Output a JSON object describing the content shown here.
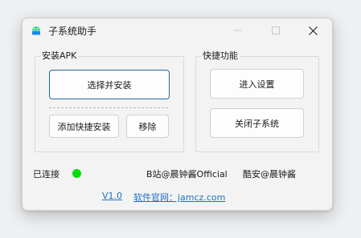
{
  "window": {
    "title": "子系统助手"
  },
  "groups": {
    "apk": {
      "legend": "安装APK",
      "select_install_label": "选择并安装",
      "add_shortcut_label": "添加快捷安装",
      "remove_label": "移除"
    },
    "quick": {
      "legend": "快捷功能",
      "enter_settings_label": "进入设置",
      "close_subsystem_label": "关闭子系统"
    }
  },
  "status": {
    "label": "已连接",
    "color": "#00e000"
  },
  "credits": {
    "bilibili": "B站@晨钟酱Official",
    "coolapk": "酷安@晨钟酱"
  },
  "footer": {
    "version": "V1.0",
    "site": "软件官网：jamcz.com"
  },
  "colors": {
    "accent": "#1f6aa6",
    "link": "#1f6fc0"
  }
}
